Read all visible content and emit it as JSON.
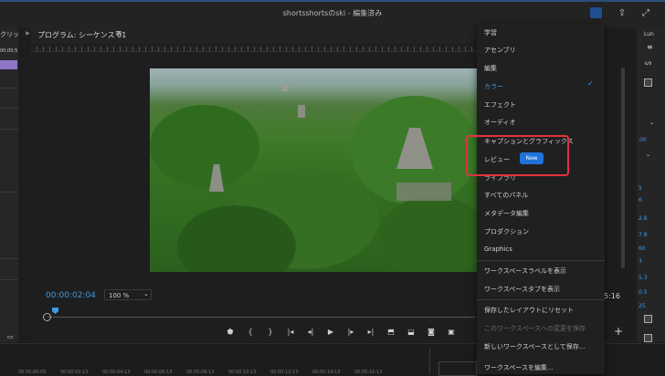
{
  "window": {
    "title": "shortsshortsのski - 編集済み"
  },
  "left_panel": {
    "header": "クリッ",
    "timecode": "00;00;5"
  },
  "monitor": {
    "tab_label": "プログラム: シーケンス 01",
    "timecode": "00:00:02:04",
    "zoom": "100 %",
    "duration_right": "5:16"
  },
  "workspace_menu": {
    "items": [
      {
        "label": "学習"
      },
      {
        "label": "アセンブリ"
      },
      {
        "label": "編集"
      },
      {
        "label": "カラー",
        "active": true
      },
      {
        "label": "エフェクト"
      },
      {
        "label": "オーディオ"
      },
      {
        "label": "キャプションとグラフィックス"
      },
      {
        "label": "レビュー",
        "badge": "New"
      },
      {
        "label": "ライブラリ"
      },
      {
        "label": "すべてのパネル"
      },
      {
        "label": "メタデータ編集"
      },
      {
        "label": "プロダクション"
      },
      {
        "label": "Graphics"
      },
      {
        "label": "ワークスペースラベルを表示"
      },
      {
        "label": "ワークスペースタブを表示"
      },
      {
        "label": "保存したレイアウトにリセット"
      },
      {
        "label": "このワークスペースへの変更を保存",
        "disabled": true
      },
      {
        "label": "新しいワークスペースとして保存..."
      },
      {
        "label": "ワークスペースを編集..."
      }
    ]
  },
  "right_panel": {
    "header": "Lun",
    "values": [
      "00",
      "5",
      "6",
      "2.8",
      "7.8",
      "60",
      "3",
      "5.3",
      "0.5",
      "25"
    ]
  },
  "bottom_timecodes": [
    "00:00:00:00",
    "00:00:02:13",
    "00:00:04:13",
    "00:00:06:13",
    "00:00:08:13",
    "00:00:10:13",
    "00:00:12:13",
    "00:00:14:13",
    "00:00:16:13"
  ],
  "colors": {
    "accent": "#3d9be9",
    "highlight": "#e3323c",
    "badge": "#1f73d9"
  }
}
